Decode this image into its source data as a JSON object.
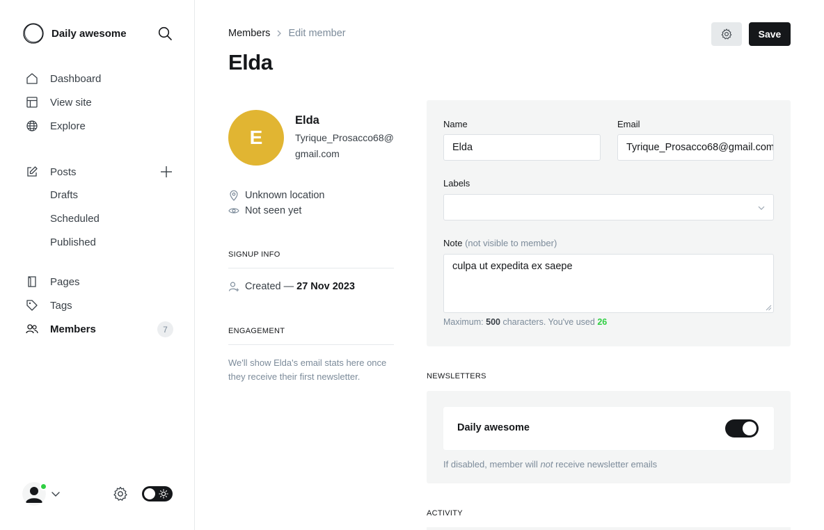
{
  "sidebar": {
    "brand_name": "Daily awesome",
    "nav": {
      "dashboard": "Dashboard",
      "view_site": "View site",
      "explore": "Explore",
      "posts": "Posts",
      "drafts": "Drafts",
      "scheduled": "Scheduled",
      "published": "Published",
      "pages": "Pages",
      "tags": "Tags",
      "members": "Members",
      "members_count": "7"
    },
    "icons": [
      "search-icon",
      "home-icon",
      "layout-icon",
      "globe-icon",
      "edit-icon",
      "plus-icon",
      "page-icon",
      "tag-icon",
      "members-icon",
      "gear-icon",
      "sun-icon"
    ]
  },
  "header": {
    "breadcrumb_parent": "Members",
    "breadcrumb_current": "Edit member",
    "title": "Elda",
    "save_label": "Save"
  },
  "member": {
    "initial": "E",
    "name": "Elda",
    "email": "Tyrique_Prosacco68@gmail.com",
    "location": "Unknown location",
    "seen": "Not seen yet",
    "avatar_color": "#e1b532"
  },
  "signup": {
    "section_label": "SIGNUP INFO",
    "created_label": "Created —",
    "created_date": "27 Nov 2023"
  },
  "engagement": {
    "section_label": "ENGAGEMENT",
    "text": "We'll show Elda's email stats here once they receive their first newsletter."
  },
  "form": {
    "name_label": "Name",
    "name_value": "Elda",
    "email_label": "Email",
    "email_value": "Tyrique_Prosacco68@gmail.com",
    "labels_label": "Labels",
    "labels_value": "",
    "note_label": "Note",
    "note_hint_label": "(not visible to member)",
    "note_value": "culpa ut expedita ex saepe",
    "char_hint_prefix": "Maximum:",
    "char_max": "500",
    "char_hint_mid": "characters. You've used",
    "char_used": "26"
  },
  "newsletters": {
    "section_label": "NEWSLETTERS",
    "items": [
      {
        "name": "Daily awesome",
        "subscribed": true
      }
    ],
    "hint_prefix": "If disabled, member will",
    "hint_em": "not",
    "hint_suffix": "receive newsletter emails"
  },
  "activity": {
    "section_label": "ACTIVITY"
  },
  "colors": {
    "accent": "#30cf43",
    "dark": "#15171a",
    "muted": "#7c8b9a",
    "panel": "#f4f5f5"
  }
}
